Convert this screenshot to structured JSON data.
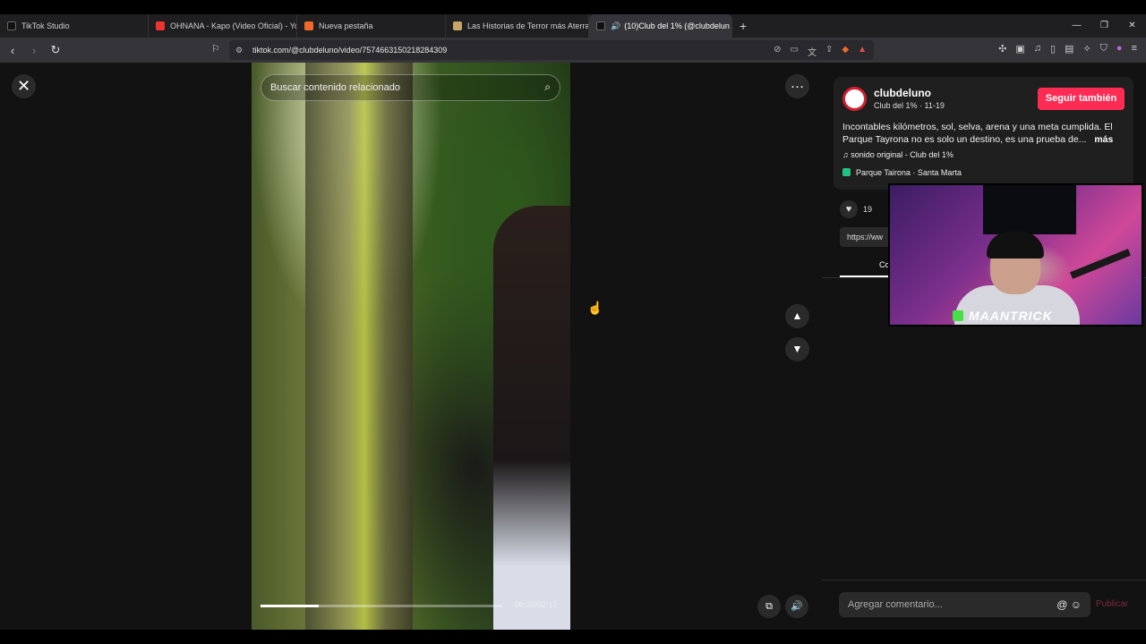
{
  "browser": {
    "tabs": [
      {
        "title": "TikTok Studio",
        "active": false
      },
      {
        "title": "OHNANA - Kapo (Video Oficial) - Yo",
        "active": false
      },
      {
        "title": "Nueva pestaña",
        "active": false
      },
      {
        "title": "Las Historias de Terror más Aterrador",
        "active": false
      },
      {
        "title": "(10)Club del 1% (@clubdelun",
        "active": true
      }
    ],
    "url": "tiktok.com/@clubdeluno/video/7574663150218284309",
    "new_tab": "+",
    "window_controls": [
      "—",
      "❐",
      "✕"
    ]
  },
  "video": {
    "search_placeholder": "Buscar contenido relacionado",
    "time_display": "00:32/02:17",
    "progress": 0.24
  },
  "post": {
    "username": "clubdeluno",
    "subtitle": "Club del 1% · 11-19",
    "follow_label": "Seguir también",
    "description": "Incontables kilómetros, sol, selva, arena y una meta cumplida. El Parque Tayrona no es solo un destino, es una prueba de...",
    "more_label": "más",
    "sound": "sonido original - Club del 1%",
    "location": "Parque Tairona · Santa Marta",
    "likes": "19",
    "link_partial": "https://ww",
    "comments_tab_partial": "Co"
  },
  "comments": {
    "placeholder": "Agregar comentario...",
    "publish_label": "Publicar"
  },
  "overlay": {
    "streamer_tag": "MAANTRICK"
  },
  "colors": {
    "accent": "#fe2c55",
    "background": "#121212"
  }
}
